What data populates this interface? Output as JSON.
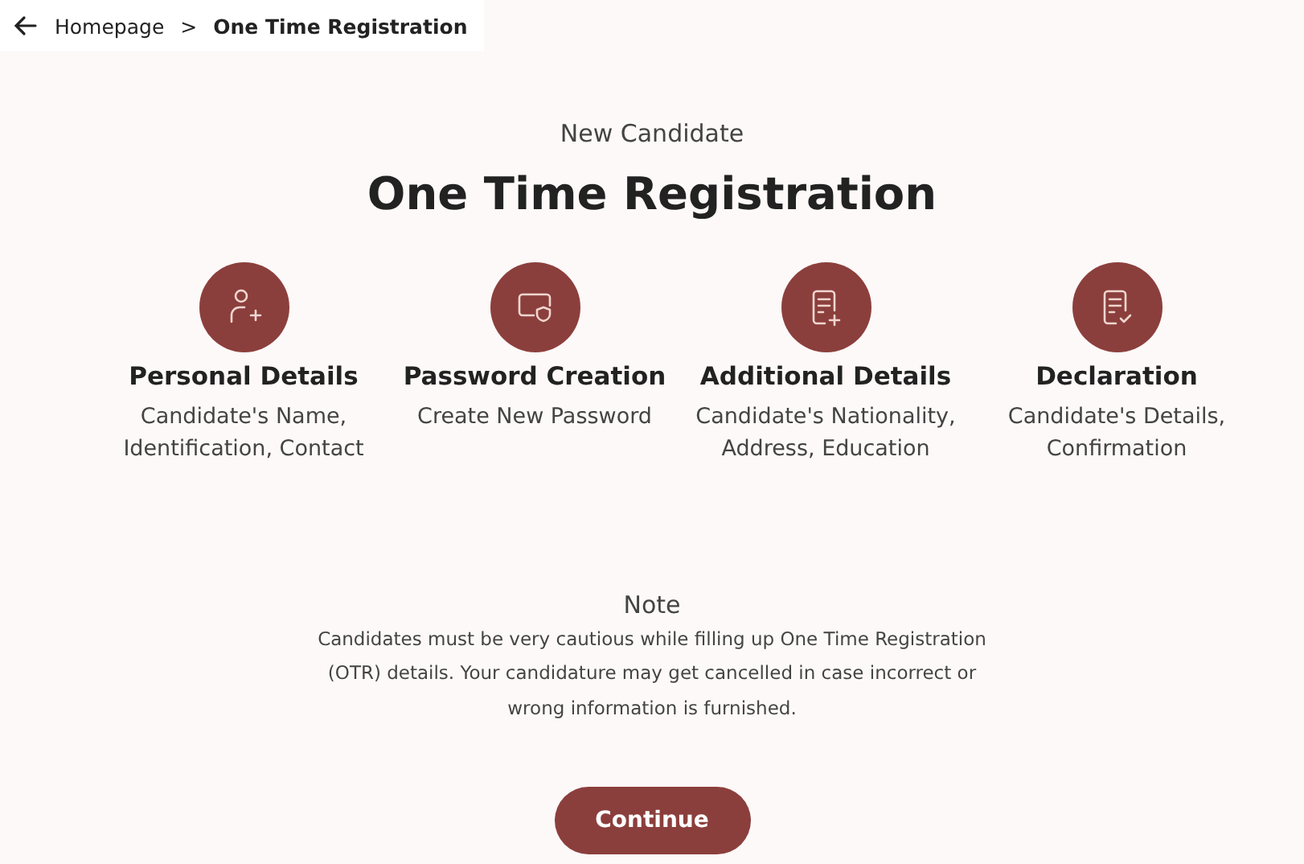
{
  "breadcrumb": {
    "items": [
      {
        "label": "Homepage",
        "current": false
      },
      {
        "label": "One Time Registration",
        "current": true
      }
    ],
    "separator": ">"
  },
  "header": {
    "subtitle": "New Candidate",
    "title": "One Time Registration"
  },
  "steps": [
    {
      "kind": "person-add",
      "title": "Personal Details",
      "description": "Candidate's Name, Identification, Contact"
    },
    {
      "kind": "card-shield",
      "title": "Password Creation",
      "description": "Create New Password"
    },
    {
      "kind": "doc-add",
      "title": "Additional Details",
      "description": "Candidate's Nationality, Address, Education"
    },
    {
      "kind": "doc-check",
      "title": "Declaration",
      "description": "Candidate's Details, Confirmation"
    }
  ],
  "note": {
    "title": "Note",
    "text": "Candidates must be very cautious while filling up One Time Registration (OTR) details. Your candidature may get cancelled in case incorrect or wrong information is furnished."
  },
  "button": {
    "label": "Continue"
  }
}
